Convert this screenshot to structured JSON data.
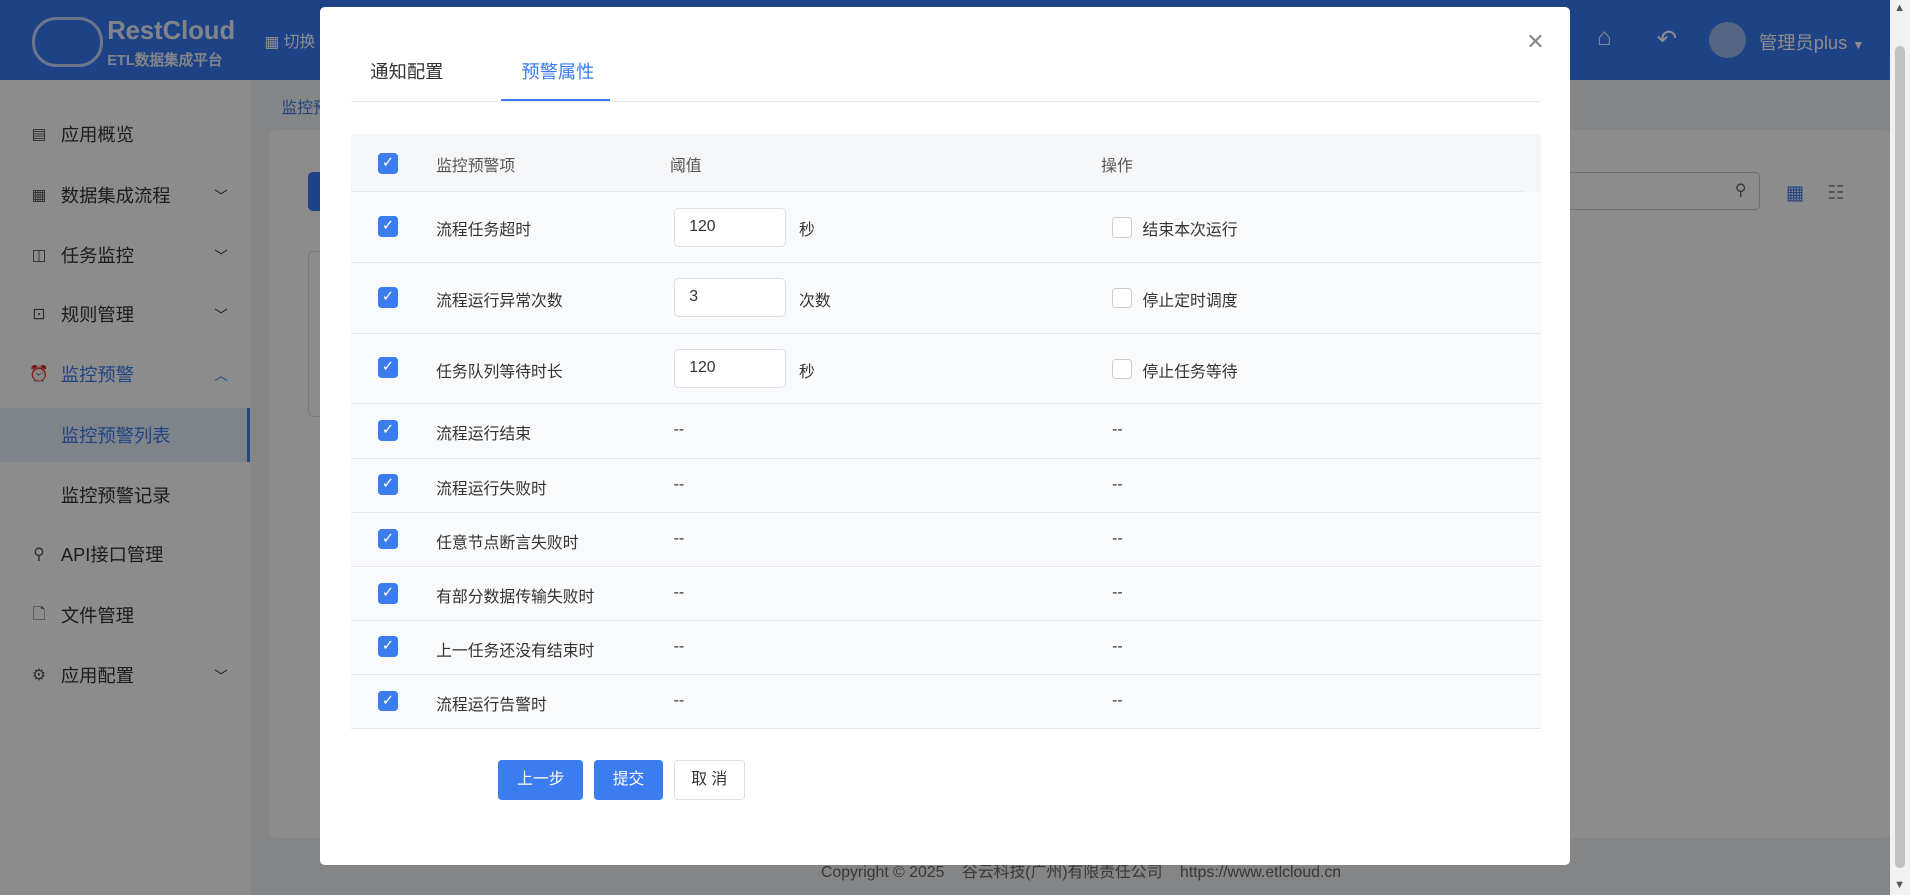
{
  "header": {
    "logo_title": "RestCloud",
    "logo_subtitle": "ETL数据集成平台",
    "switch_label": "切换",
    "user": "管理员plus"
  },
  "sidebar": {
    "items": [
      {
        "label": "应用概览",
        "icon": "dashboard-icon"
      },
      {
        "label": "数据集成流程",
        "icon": "grid-icon"
      },
      {
        "label": "任务监控",
        "icon": "monitor-icon"
      },
      {
        "label": "规则管理",
        "icon": "terminal-icon"
      },
      {
        "label": "监控预警",
        "icon": "alarm-icon"
      },
      {
        "label": "监控预警列表"
      },
      {
        "label": "监控预警记录"
      },
      {
        "label": "API接口管理",
        "icon": "api-icon"
      },
      {
        "label": "文件管理",
        "icon": "file-icon"
      },
      {
        "label": "应用配置",
        "icon": "gear-icon"
      }
    ]
  },
  "breadcrumb": "监控预",
  "footer": "Copyright © 2025    谷云科技(广州)有限责任公司    https://www.etlcloud.cn",
  "dialog": {
    "tabs": [
      "通知配置",
      "预警属性"
    ],
    "active_tab": "预警属性",
    "columns": [
      "监控预警项",
      "阈值",
      "操作"
    ],
    "rows": [
      {
        "name": "流程任务超时",
        "value": "120",
        "unit": "秒",
        "action": "结束本次运行",
        "checked": true,
        "action_checked": false
      },
      {
        "name": "流程运行异常次数",
        "value": "3",
        "unit": "次数",
        "action": "停止定时调度",
        "checked": true,
        "action_checked": false
      },
      {
        "name": "任务队列等待时长",
        "value": "120",
        "unit": "秒",
        "action": "停止任务等待",
        "checked": true,
        "action_checked": false
      },
      {
        "name": "流程运行结束",
        "value": "--",
        "action": "--",
        "checked": true
      },
      {
        "name": "流程运行失败时",
        "value": "--",
        "action": "--",
        "checked": true
      },
      {
        "name": "任意节点断言失败时",
        "value": "--",
        "action": "--",
        "checked": true
      },
      {
        "name": "有部分数据传输失败时",
        "value": "--",
        "action": "--",
        "checked": true
      },
      {
        "name": "上一任务还没有结束时",
        "value": "--",
        "action": "--",
        "checked": true
      },
      {
        "name": "流程运行告警时",
        "value": "--",
        "action": "--",
        "checked": true
      }
    ],
    "buttons": {
      "prev": "上一步",
      "submit": "提交",
      "cancel": "取 消"
    }
  },
  "colors": {
    "accent": "#3b7cf0",
    "header": "#3878f5"
  }
}
